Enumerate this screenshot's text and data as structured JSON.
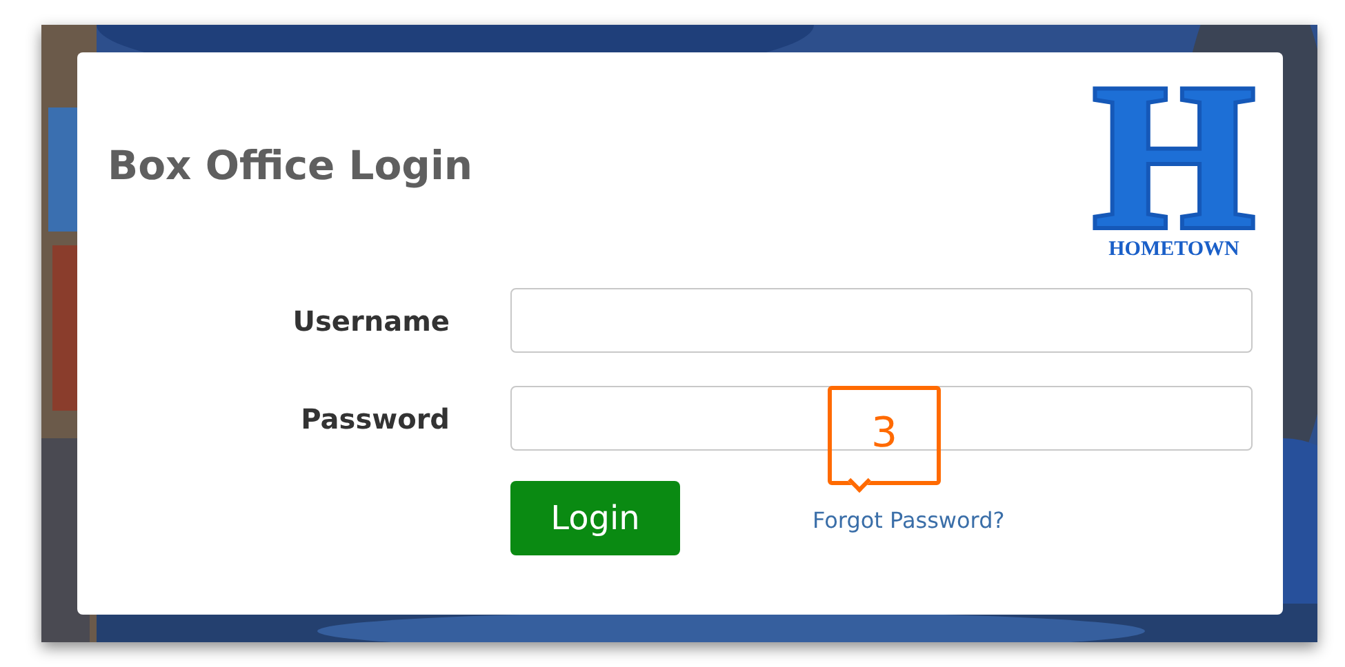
{
  "title": "Box Office Login",
  "logo": {
    "letter": "H",
    "name": "HOMETOWN"
  },
  "fields": [
    {
      "label": "Username"
    },
    {
      "label": "Password"
    }
  ],
  "login_button": "Login",
  "forgot_link": "Forgot Password?",
  "callout": "3"
}
